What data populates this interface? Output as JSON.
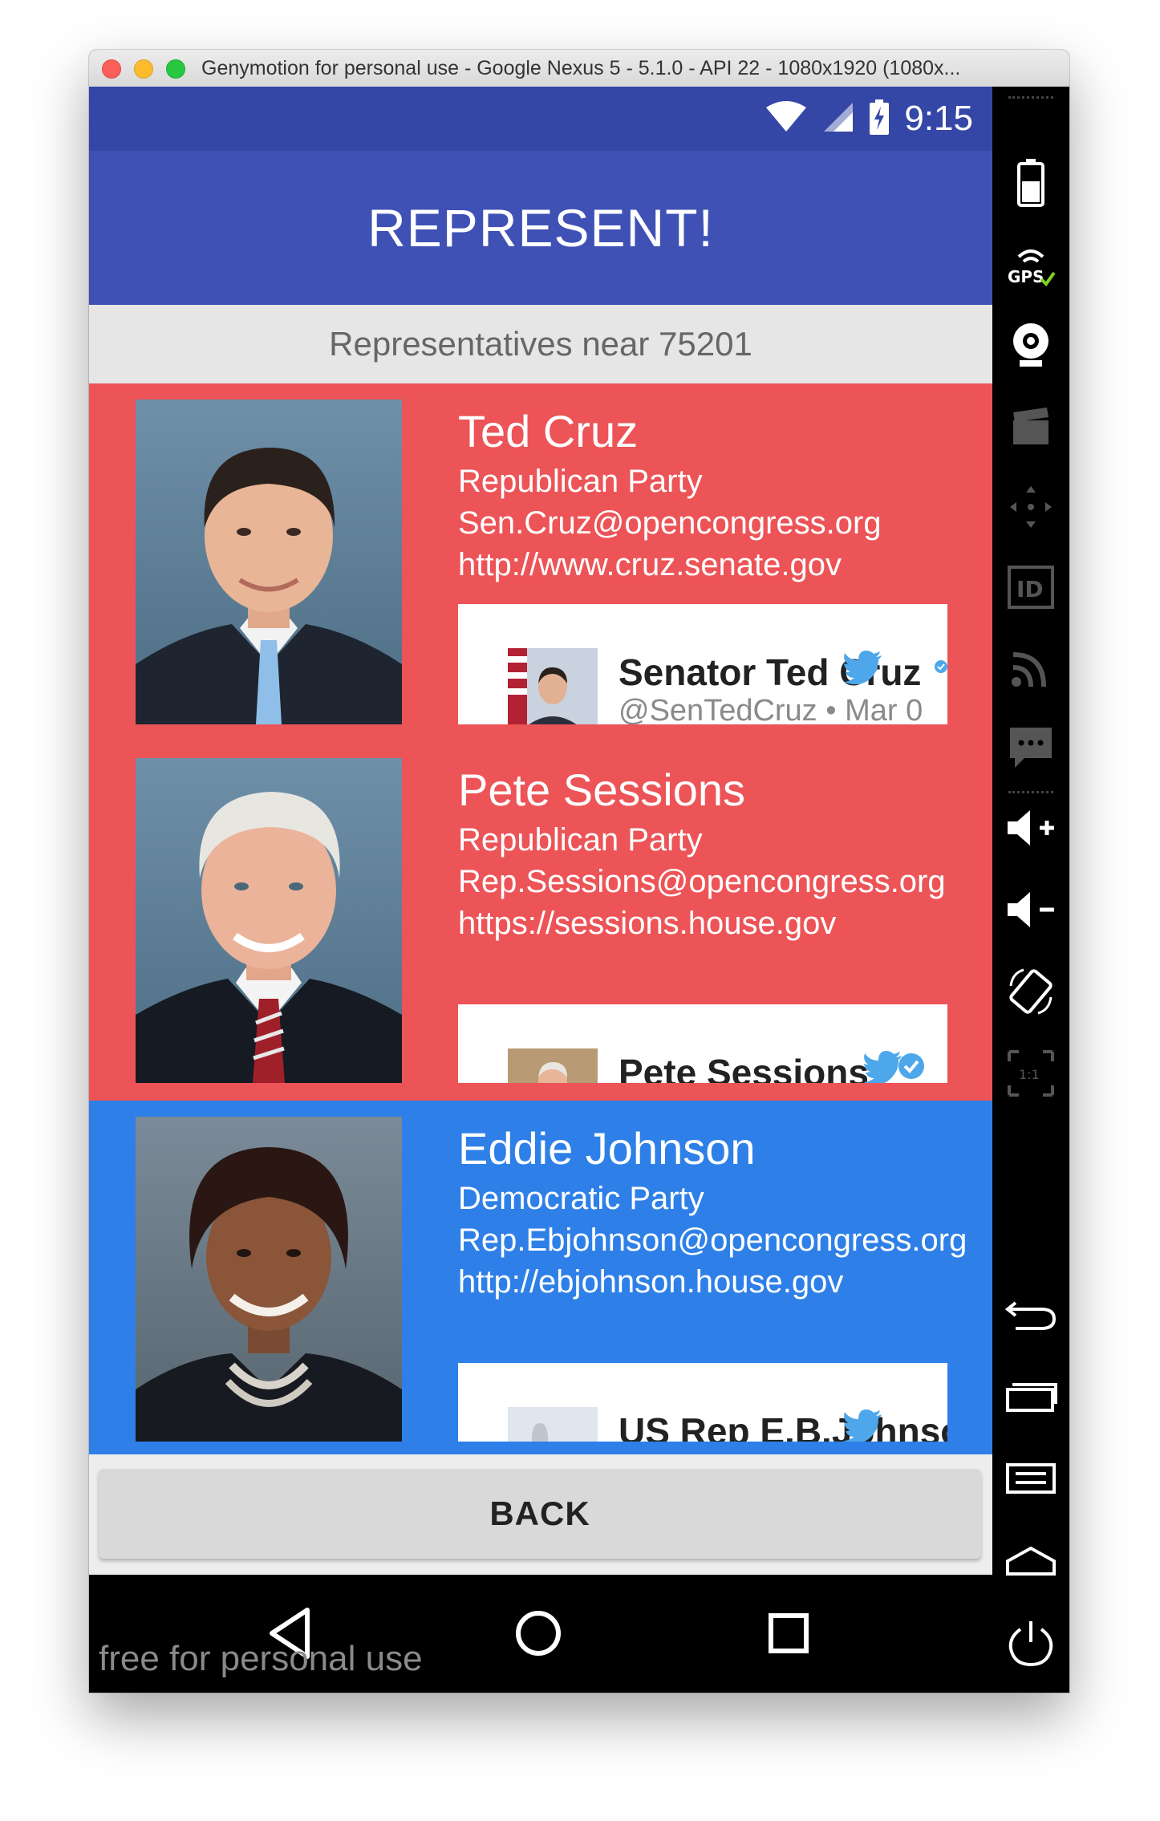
{
  "window": {
    "title": "Genymotion for personal use - Google Nexus 5 - 5.1.0 - API 22 - 1080x1920 (1080x..."
  },
  "statusbar": {
    "time": "9:15"
  },
  "app": {
    "title": "REPRESENT!",
    "subheader": "Representatives near 75201",
    "back_label": "BACK"
  },
  "colors": {
    "republican": "#ec5457",
    "democratic": "#2e80e8",
    "appbar": "#3f51b5",
    "twitter": "#4da7ea"
  },
  "representatives": [
    {
      "name": "Ted Cruz",
      "party": "Republican Party",
      "email": "Sen.Cruz@opencongress.org",
      "website": "http://www.cruz.senate.gov",
      "tweet_name": "Senator Ted Cruz",
      "tweet_handle": "@SenTedCruz • Mar 0"
    },
    {
      "name": "Pete Sessions",
      "party": "Republican Party",
      "email": "Rep.Sessions@opencongress.org",
      "website": "https://sessions.house.gov",
      "tweet_name": "Pete Sessions"
    },
    {
      "name": "Eddie Johnson",
      "party": "Democratic Party",
      "email": "Rep.Ebjohnson@opencongress.org",
      "website": "http://ebjohnson.house.gov",
      "tweet_name": "US Rep E.B.Johnson..."
    }
  ],
  "navbar": {
    "watermark": "free for personal use"
  },
  "sidebar": {
    "items": [
      "battery-icon",
      "gps-icon",
      "webcam-icon",
      "video-capture-icon",
      "dpad-icon",
      "device-id-icon",
      "network-icon",
      "sms-icon",
      "volume-up-icon",
      "volume-down-icon",
      "rotate-icon",
      "pixel-perfect-icon",
      "back-icon",
      "recent-apps-icon",
      "menu-icon",
      "home-icon",
      "power-icon"
    ]
  }
}
